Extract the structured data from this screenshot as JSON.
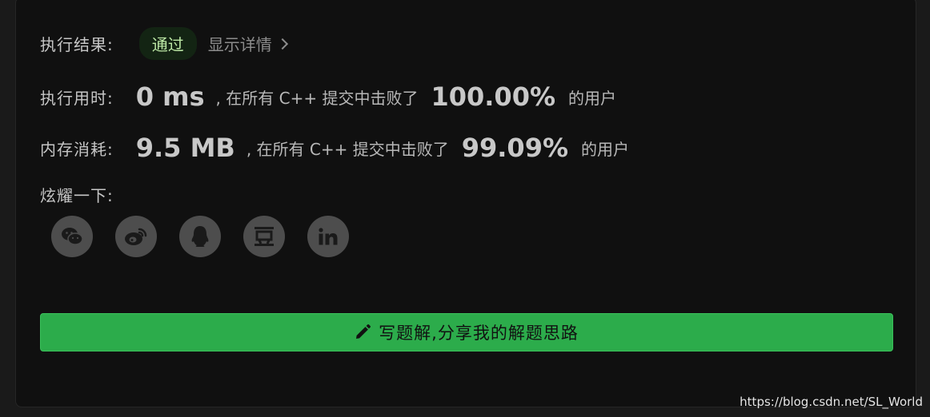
{
  "result": {
    "label": "执行结果:",
    "status": "通过",
    "details_link": "显示详情"
  },
  "runtime": {
    "label": "执行用时:",
    "value": "0 ms",
    "middle_text": ", 在所有 C++ 提交中击败了",
    "percent": "100.00%",
    "tail": "的用户"
  },
  "memory": {
    "label": "内存消耗:",
    "value": "9.5 MB",
    "middle_text": ", 在所有 C++ 提交中击败了",
    "percent": "99.09%",
    "tail": "的用户"
  },
  "share": {
    "label": "炫耀一下:",
    "icons": [
      "wechat-icon",
      "weibo-icon",
      "qq-icon",
      "douban-icon",
      "linkedin-icon"
    ]
  },
  "write_solution_button": "写题解,分享我的解题思路",
  "watermark": "https://blog.csdn.net/SL_World",
  "colors": {
    "background": "#101010",
    "badge_text": "#bde9a6",
    "button_green": "#2cac4b"
  }
}
